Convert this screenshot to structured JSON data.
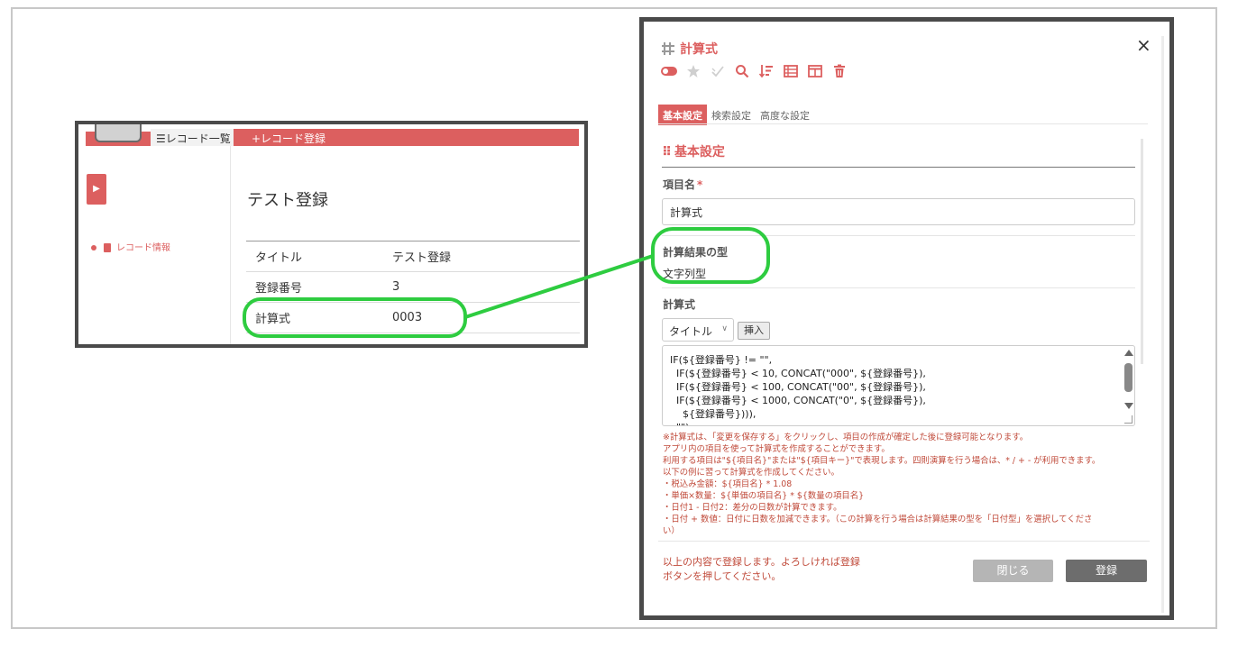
{
  "app": {
    "tab_list": "レコード一覧",
    "tab_register": "+レコード登録",
    "sidebar_item": "レコード情報"
  },
  "record": {
    "title": "テスト登録",
    "rows": [
      {
        "key": "タイトル",
        "value": "テスト登録"
      },
      {
        "key": "登録番号",
        "value": "3"
      },
      {
        "key": "計算式",
        "value": "0003"
      }
    ]
  },
  "dialog": {
    "title": "計算式",
    "close_glyph": "×",
    "toolbar_icons": [
      "toggle-icon",
      "star-icon",
      "check-icon",
      "search-icon",
      "sort-icon",
      "list-icon",
      "columns-icon",
      "trash-icon"
    ],
    "tabs": [
      {
        "label": "基本設定",
        "active": true
      },
      {
        "label": "検索設定",
        "active": false
      },
      {
        "label": "高度な設定",
        "active": false
      }
    ],
    "section_title": "基本設定",
    "item_name_label": "項目名",
    "required_mark": "*",
    "item_name_value": "計算式",
    "result_type_label": "計算結果の型",
    "result_type_value": "文字列型",
    "formula_label": "計算式",
    "field_select": "タイトル",
    "insert_button": "挿入",
    "formula": "IF(${登録番号} != \"\",\n  IF(${登録番号} < 10, CONCAT(\"000\", ${登録番号}),\n  IF(${登録番号} < 100, CONCAT(\"00\", ${登録番号}),\n  IF(${登録番号} < 1000, CONCAT(\"0\", ${登録番号}),\n    ${登録番号}))),\n  \"\")",
    "notes": [
      "※計算式は、「変更を保存する」をクリックし、項目の作成が確定した後に登録可能となります。",
      "アプリ内の項目を使って計算式を作成することができます。",
      "利用する項目は\"${項目名}\"または\"${項目キー}\"で表現します。四則演算を行う場合は、* / + - が利用できます。",
      "以下の例に習って計算式を作成してください。",
      "・税込み金額：${項目名} * 1.08",
      "・単価×数量：${単価の項目名} * ${数量の項目名}",
      "・日付1 - 日付2：差分の日数が計算できます。",
      "・日付 + 数値：日付に日数を加減できます。（この計算を行う場合は計算結果の型を「日付型」を選択してくださ",
      "い）"
    ],
    "footer_message": "以上の内容で登録します。よろしければ登録ボタンを押してください。",
    "close_button": "閉じる",
    "register_button": "登録"
  },
  "colors": {
    "accent": "#dc5f5f",
    "callout": "#2ecc40",
    "frame": "#4a4a4a"
  }
}
